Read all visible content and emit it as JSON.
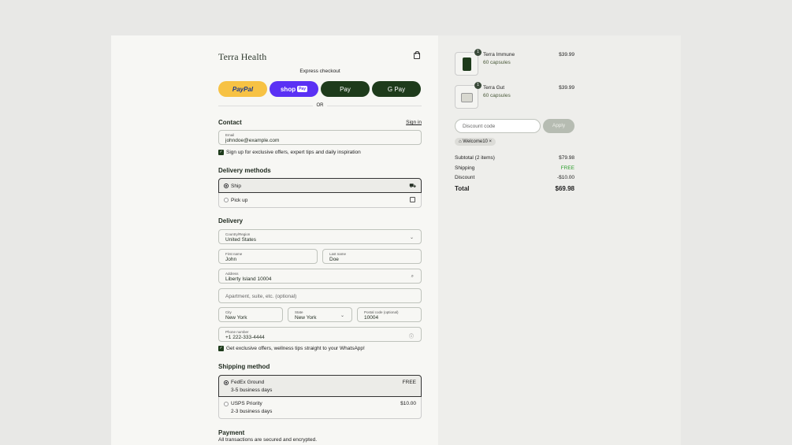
{
  "brand": {
    "logo_text": "Terra Health"
  },
  "header": {
    "cart_icon": "shopping-bag-icon"
  },
  "express": {
    "title": "Express checkout",
    "paypal": "PayPal",
    "shop": "shop",
    "shop_badge": "Pay",
    "apple": " Pay",
    "google": "G Pay",
    "or_label": "OR"
  },
  "contact": {
    "heading": "Contact",
    "sign_in": "Sign in",
    "email_label": "Email",
    "email_value": "johndoe@example.com",
    "newsletter_label": "Sign up for exclusive offers, expert tips and daily inspiration",
    "newsletter_checked": true
  },
  "delivery_methods": {
    "heading": "Delivery methods",
    "options": [
      {
        "label": "Ship",
        "selected": true,
        "icon": "truck-icon"
      },
      {
        "label": "Pick up",
        "selected": false,
        "icon": "store-icon"
      }
    ]
  },
  "delivery": {
    "heading": "Delivery",
    "country_label": "Country/Region",
    "country_value": "United States",
    "first_name_label": "First name",
    "first_name_value": "John",
    "last_name_label": "Last name",
    "last_name_value": "Doe",
    "address_label": "Address",
    "address_value": "Liberty Island 10004",
    "apartment_placeholder": "Apartment, suite, etc. (optional)",
    "city_label": "City",
    "city_value": "New York",
    "state_label": "State",
    "state_value": "New York",
    "postal_label": "Postal code (optional)",
    "postal_value": "10004",
    "phone_label": "Phone number",
    "phone_value": "+1 222-333-4444",
    "whatsapp_label": "Get exclusive offers, wellness tips straight to your WhatsApp!",
    "whatsapp_checked": true
  },
  "shipping": {
    "heading": "Shipping method",
    "options": [
      {
        "name": "FedEx Ground",
        "eta": "3-5 business days",
        "price": "FREE",
        "selected": true
      },
      {
        "name": "USPS Priority",
        "eta": "2-3 business days",
        "price": "$10.00",
        "selected": false
      }
    ]
  },
  "payment": {
    "heading": "Payment",
    "note": "All transactions are secured and encrypted."
  },
  "cart": {
    "items": [
      {
        "name": "Terra Immune",
        "variant": "60 capsules",
        "price": "$39.99",
        "qty": "1"
      },
      {
        "name": "Terra Gut",
        "variant": "60 capsules",
        "price": "$39.99",
        "qty": "1"
      }
    ],
    "discount_placeholder": "Discount code",
    "apply_label": "Apply",
    "applied_code": "Welcome10",
    "summary": {
      "subtotal_label": "Subtotal (2 items)",
      "subtotal_value": "$79.98",
      "shipping_label": "Shipping",
      "shipping_value": "FREE",
      "discount_label": "Discount",
      "discount_value": "-$10.00",
      "total_label": "Total",
      "total_value": "$69.98"
    }
  },
  "colors": {
    "brand_green": "#1e3b1b",
    "free_green": "#2e9e2e",
    "paypal_yellow": "#f7c244",
    "shop_purple": "#5a31f4"
  }
}
